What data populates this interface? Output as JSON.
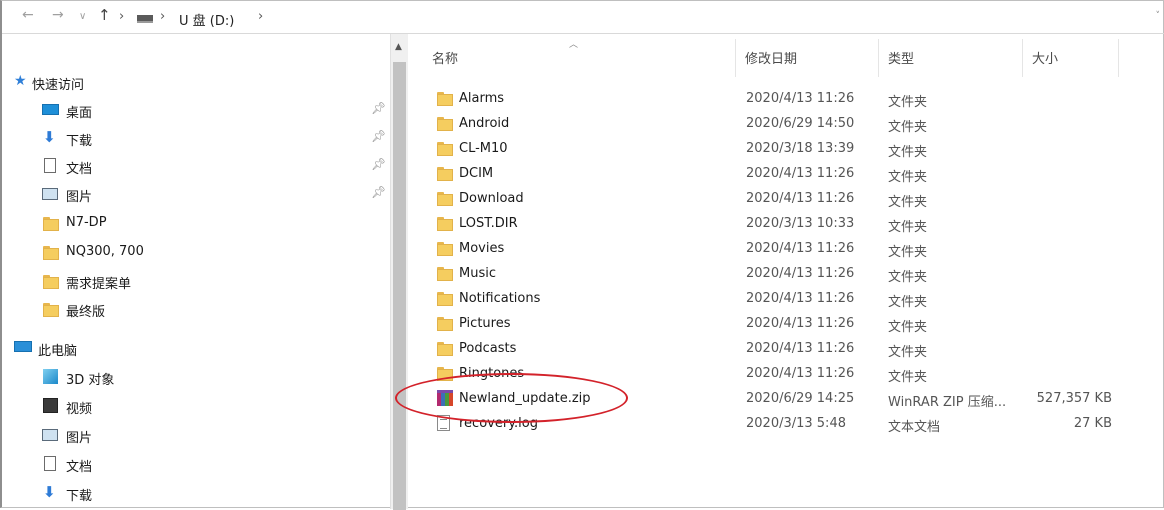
{
  "address": {
    "back": "←",
    "forward": "→",
    "recent": "∨",
    "up": "↑",
    "crumbs": [
      "U 盘 (D:)"
    ],
    "separator": "›"
  },
  "nav_pane": {
    "quick_access": "快速访问",
    "quick_items": [
      {
        "label": "桌面",
        "icon": "desktop-icon",
        "pinned": true
      },
      {
        "label": "下载",
        "icon": "download-icon",
        "pinned": true
      },
      {
        "label": "文档",
        "icon": "document-icon",
        "pinned": true
      },
      {
        "label": "图片",
        "icon": "pictures-icon",
        "pinned": true
      },
      {
        "label": "N7-DP",
        "icon": "folder-icon",
        "pinned": false
      },
      {
        "label": "NQ300, 700",
        "icon": "folder-icon",
        "pinned": false
      },
      {
        "label": "需求提案单",
        "icon": "folder-icon",
        "pinned": false
      },
      {
        "label": "最终版",
        "icon": "folder-icon",
        "pinned": false
      }
    ],
    "this_pc": "此电脑",
    "pc_items": [
      {
        "label": "3D 对象",
        "icon": "3d-objects-icon"
      },
      {
        "label": "视频",
        "icon": "video-icon"
      },
      {
        "label": "图片",
        "icon": "pictures-icon"
      },
      {
        "label": "文档",
        "icon": "document-icon"
      },
      {
        "label": "下载",
        "icon": "download-icon"
      }
    ]
  },
  "columns": {
    "name": "名称",
    "date": "修改日期",
    "type": "类型",
    "size": "大小"
  },
  "files": [
    {
      "name": "Alarms",
      "date": "2020/4/13 11:26",
      "type": "文件夹",
      "size": "",
      "kind": "folder"
    },
    {
      "name": "Android",
      "date": "2020/6/29 14:50",
      "type": "文件夹",
      "size": "",
      "kind": "folder"
    },
    {
      "name": "CL-M10",
      "date": "2020/3/18 13:39",
      "type": "文件夹",
      "size": "",
      "kind": "folder"
    },
    {
      "name": "DCIM",
      "date": "2020/4/13 11:26",
      "type": "文件夹",
      "size": "",
      "kind": "folder"
    },
    {
      "name": "Download",
      "date": "2020/4/13 11:26",
      "type": "文件夹",
      "size": "",
      "kind": "folder"
    },
    {
      "name": "LOST.DIR",
      "date": "2020/3/13 10:33",
      "type": "文件夹",
      "size": "",
      "kind": "folder"
    },
    {
      "name": "Movies",
      "date": "2020/4/13 11:26",
      "type": "文件夹",
      "size": "",
      "kind": "folder"
    },
    {
      "name": "Music",
      "date": "2020/4/13 11:26",
      "type": "文件夹",
      "size": "",
      "kind": "folder"
    },
    {
      "name": "Notifications",
      "date": "2020/4/13 11:26",
      "type": "文件夹",
      "size": "",
      "kind": "folder"
    },
    {
      "name": "Pictures",
      "date": "2020/4/13 11:26",
      "type": "文件夹",
      "size": "",
      "kind": "folder"
    },
    {
      "name": "Podcasts",
      "date": "2020/4/13 11:26",
      "type": "文件夹",
      "size": "",
      "kind": "folder"
    },
    {
      "name": "Ringtones",
      "date": "2020/4/13 11:26",
      "type": "文件夹",
      "size": "",
      "kind": "folder"
    },
    {
      "name": "Newland_update.zip",
      "date": "2020/6/29 14:25",
      "type": "WinRAR ZIP 压缩...",
      "size": "527,357 KB",
      "kind": "zip"
    },
    {
      "name": "recovery.log",
      "date": "2020/3/13 5:48",
      "type": "文本文档",
      "size": "27 KB",
      "kind": "log"
    }
  ],
  "annotation": {
    "highlighted_file": "Newland_update.zip",
    "color": "#d3222a"
  }
}
